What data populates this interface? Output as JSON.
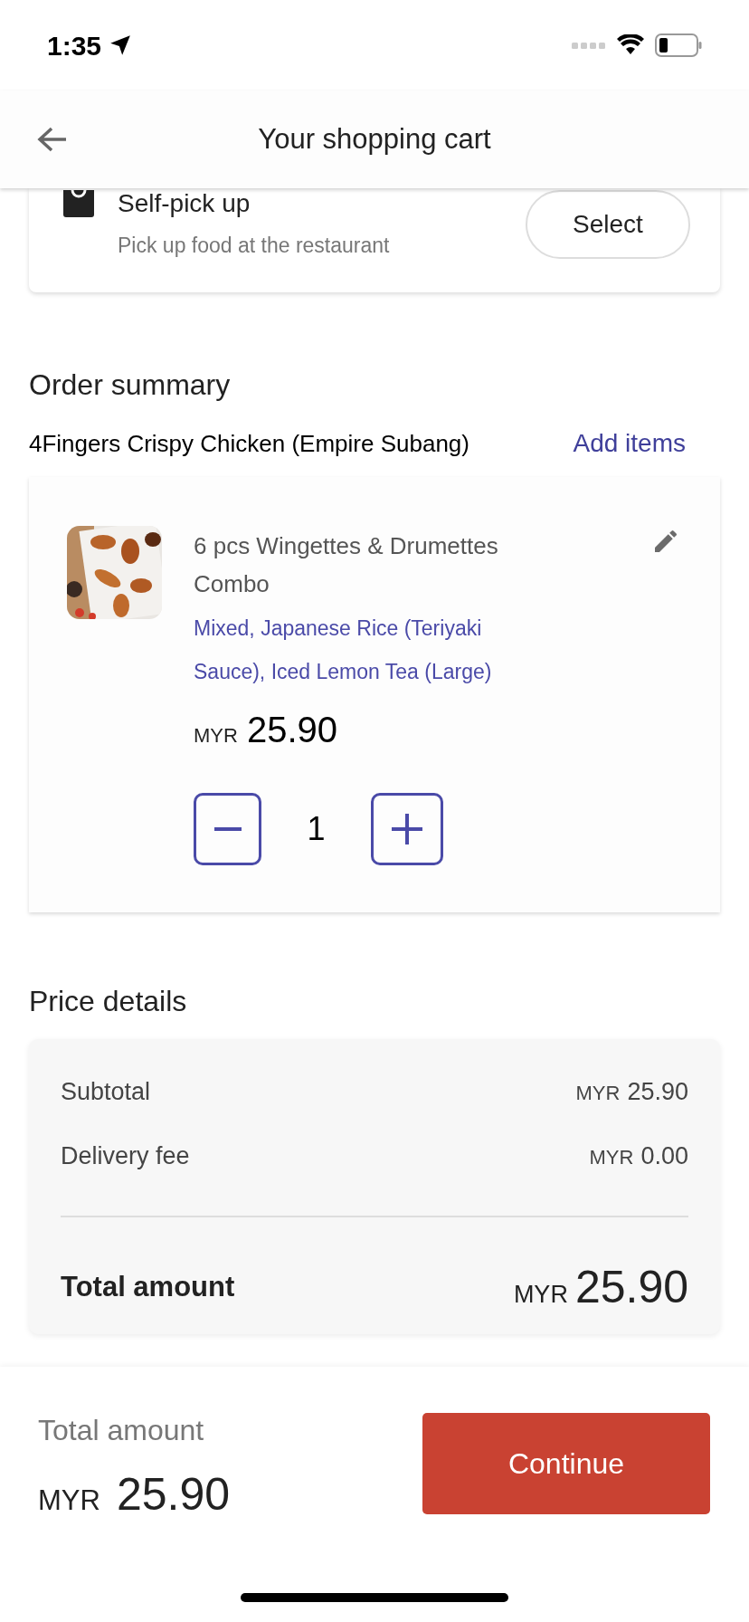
{
  "status_bar": {
    "time": "1:35"
  },
  "header": {
    "title": "Your shopping cart"
  },
  "pickup_option": {
    "title": "Self-pick up",
    "subtitle": "Pick up food at the restaurant",
    "button": "Select"
  },
  "order_summary": {
    "heading": "Order summary",
    "restaurant": "4Fingers Crispy Chicken (Empire Subang)",
    "add_items": "Add items",
    "items": [
      {
        "name": "6 pcs Wingettes & Drumettes Combo",
        "options": "Mixed, Japanese Rice (Teriyaki Sauce), Iced Lemon Tea (Large)",
        "currency": "MYR",
        "price": "25.90",
        "quantity": "1"
      }
    ]
  },
  "price_details": {
    "heading": "Price details",
    "rows": [
      {
        "label": "Subtotal",
        "currency": "MYR",
        "amount": "25.90"
      },
      {
        "label": "Delivery fee",
        "currency": "MYR",
        "amount": "0.00"
      }
    ],
    "total": {
      "label": "Total amount",
      "currency": "MYR",
      "amount": "25.90"
    }
  },
  "footer": {
    "label": "Total amount",
    "currency": "MYR",
    "amount": "25.90",
    "button": "Continue"
  }
}
